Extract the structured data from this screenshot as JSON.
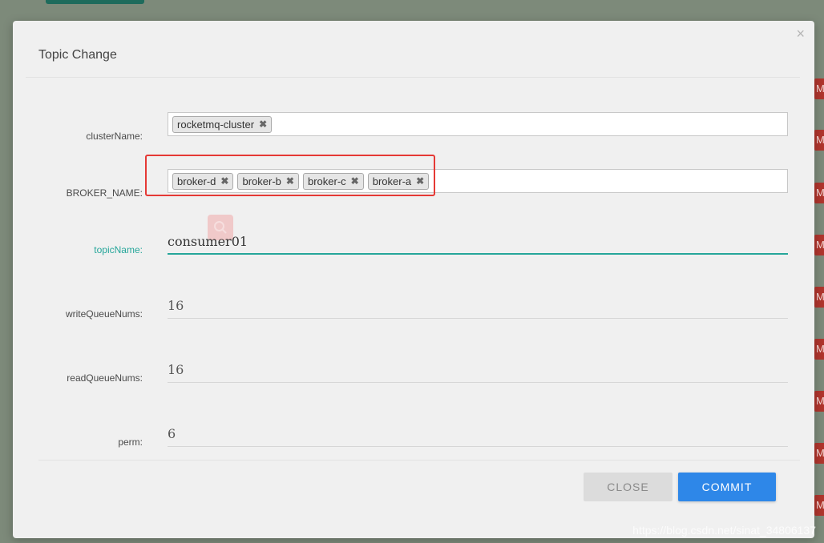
{
  "background": {
    "badges": [
      "M",
      "M",
      "M",
      "M",
      "M",
      "M",
      "M",
      "M",
      "M",
      "M"
    ]
  },
  "modal": {
    "title": "Topic Change",
    "close_glyph": "×"
  },
  "form": {
    "cluster_name": {
      "label": "clusterName:",
      "tags": [
        "rocketmq-cluster"
      ]
    },
    "broker_name": {
      "label": "BROKER_NAME:",
      "tags": [
        "broker-d",
        "broker-b",
        "broker-c",
        "broker-a"
      ]
    },
    "topic_name": {
      "label": "topicName:",
      "value": "consumer01"
    },
    "write_queue_nums": {
      "label": "writeQueueNums:",
      "value": "16"
    },
    "read_queue_nums": {
      "label": "readQueueNums:",
      "value": "16"
    },
    "perm": {
      "label": "perm:",
      "value": "6"
    }
  },
  "footer": {
    "close_label": "CLOSE",
    "commit_label": "COMMIT"
  },
  "watermark": "https://blog.csdn.net/sinat_34806137",
  "colors": {
    "accent": "#26a69a",
    "primary_button": "#2e87e8",
    "highlight": "#e53935"
  }
}
